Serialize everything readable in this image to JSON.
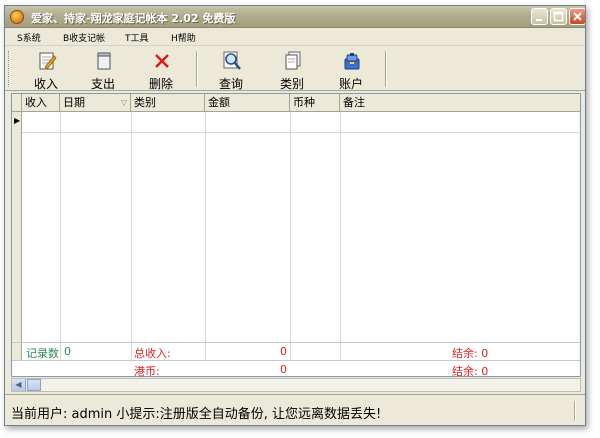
{
  "window": {
    "title": "爱家、持家-翔龙家庭记帐本 2.02 免费版"
  },
  "menu": [
    {
      "label": "S系统"
    },
    {
      "label": "B收支记帐"
    },
    {
      "label": "T工具"
    },
    {
      "label": "H帮助"
    }
  ],
  "toolbar": {
    "income": "收入",
    "expense": "支出",
    "delete": "删除",
    "query": "查询",
    "category": "类别",
    "account": "账户"
  },
  "grid": {
    "columns": [
      "收入",
      "日期",
      "类别",
      "金额",
      "币种",
      "备注"
    ],
    "sort_glyph": "▽",
    "row_marker": "▶",
    "footer1": {
      "count_label": "记录数",
      "count_value": "0",
      "total_income_label": "总收入:",
      "total_income_value": "0",
      "balance": "结余: 0"
    },
    "footer2": {
      "currency_label": "港币:",
      "currency_value": "0",
      "balance": "结余: 0"
    }
  },
  "status": {
    "text": "当前用户: admin    小提示:注册版全自动备份, 让您远离数据丢失!"
  },
  "icons": {
    "app": "app-icon",
    "minimize": "minimize-icon",
    "maximize": "maximize-icon",
    "close": "close-icon"
  }
}
